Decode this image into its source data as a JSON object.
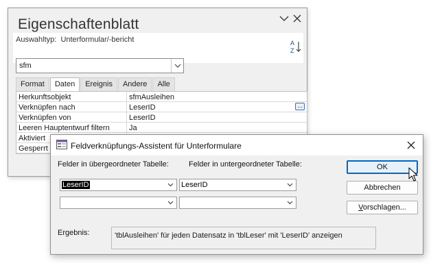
{
  "property_sheet": {
    "title": "Eigenschaftenblatt",
    "selection_type_label": "Auswahltyp:",
    "selection_type_value": "Unterformular/-bericht",
    "object_combo_value": "sfm",
    "tabs": [
      {
        "label": "Format",
        "active": false
      },
      {
        "label": "Daten",
        "active": true
      },
      {
        "label": "Ereignis",
        "active": false
      },
      {
        "label": "Andere",
        "active": false
      },
      {
        "label": "Alle",
        "active": false
      }
    ],
    "rows": [
      {
        "key": "Herkunftsobjekt",
        "value": "sfmAusleihen"
      },
      {
        "key": "Verknüpfen nach",
        "value": "LeserID"
      },
      {
        "key": "Verknüpfen von",
        "value": "LeserID"
      },
      {
        "key": "Leeren Hauptentwurf filtern",
        "value": "Ja"
      },
      {
        "key": "Aktiviert",
        "value": ""
      },
      {
        "key": "Gesperrt",
        "value": ""
      }
    ],
    "build_button_label": "..."
  },
  "dialog": {
    "title": "Feldverknüpfungs-Assistent für Unterformulare",
    "parent_label": "Felder in übergeordneter Tabelle:",
    "child_label": "Felder in untergeordneter Tabelle:",
    "parent_field_1": "LeserID",
    "child_field_1": "LeserID",
    "parent_field_2": "",
    "child_field_2": "",
    "ok_label": "OK",
    "cancel_label": "Abbrechen",
    "suggest_label_underlined": "V",
    "suggest_label_rest": "orschlagen...",
    "result_label": "Ergebnis:",
    "result_text": "'tblAusleihen' für jeden Datensatz in 'tblLeser' mit 'LeserID' anzeigen"
  },
  "colors": {
    "accent": "#0067c0",
    "window_bg": "#f0f0f0"
  },
  "icons": [
    "chevron-down-icon",
    "close-icon",
    "sort-az-icon",
    "form-wizard-icon",
    "mouse-pointer-icon"
  ]
}
